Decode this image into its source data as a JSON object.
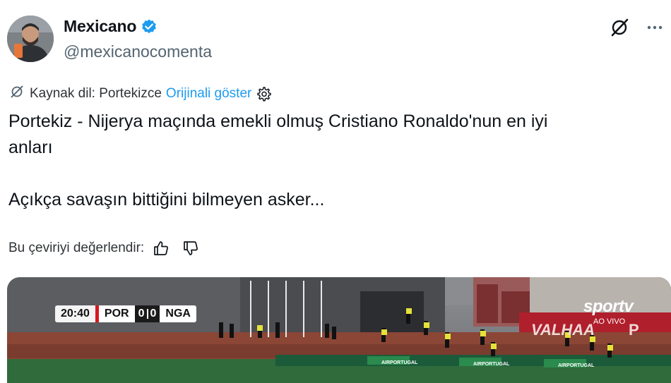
{
  "author": {
    "display_name": "Mexicano",
    "handle": "@mexicanocomenta",
    "verified_icon": "verified-badge-icon",
    "verified_color": "#1d9bf0"
  },
  "actions": {
    "grok_icon": "grok-icon",
    "more_icon": "more-options-icon"
  },
  "translation": {
    "icon": "translate-icon",
    "source_label": "Kaynak dil: Portekizce",
    "show_original": "Orijinali göster",
    "settings_icon": "gear-icon",
    "link_color": "#1d9bf0"
  },
  "tweet": {
    "line1": "Portekiz - Nijerya maçında emekli olmuş Cristiano Ronaldo'nun en iyi",
    "line2": "anları",
    "line3": "Açıkça savaşın bittiğini bilmeyen asker..."
  },
  "rating": {
    "label": "Bu çeviriyi değerlendir:",
    "thumbs_up_icon": "thumbs-up-icon",
    "thumbs_down_icon": "thumbs-down-icon"
  },
  "video": {
    "clock": "20:40",
    "home": "POR",
    "home_score": "0",
    "away_score": "0",
    "away": "NGA",
    "broadcaster": "sportv",
    "live_label": "AO VIVO",
    "banner_text": "VALHAA",
    "board_text": "AIRPORTUGAL"
  }
}
